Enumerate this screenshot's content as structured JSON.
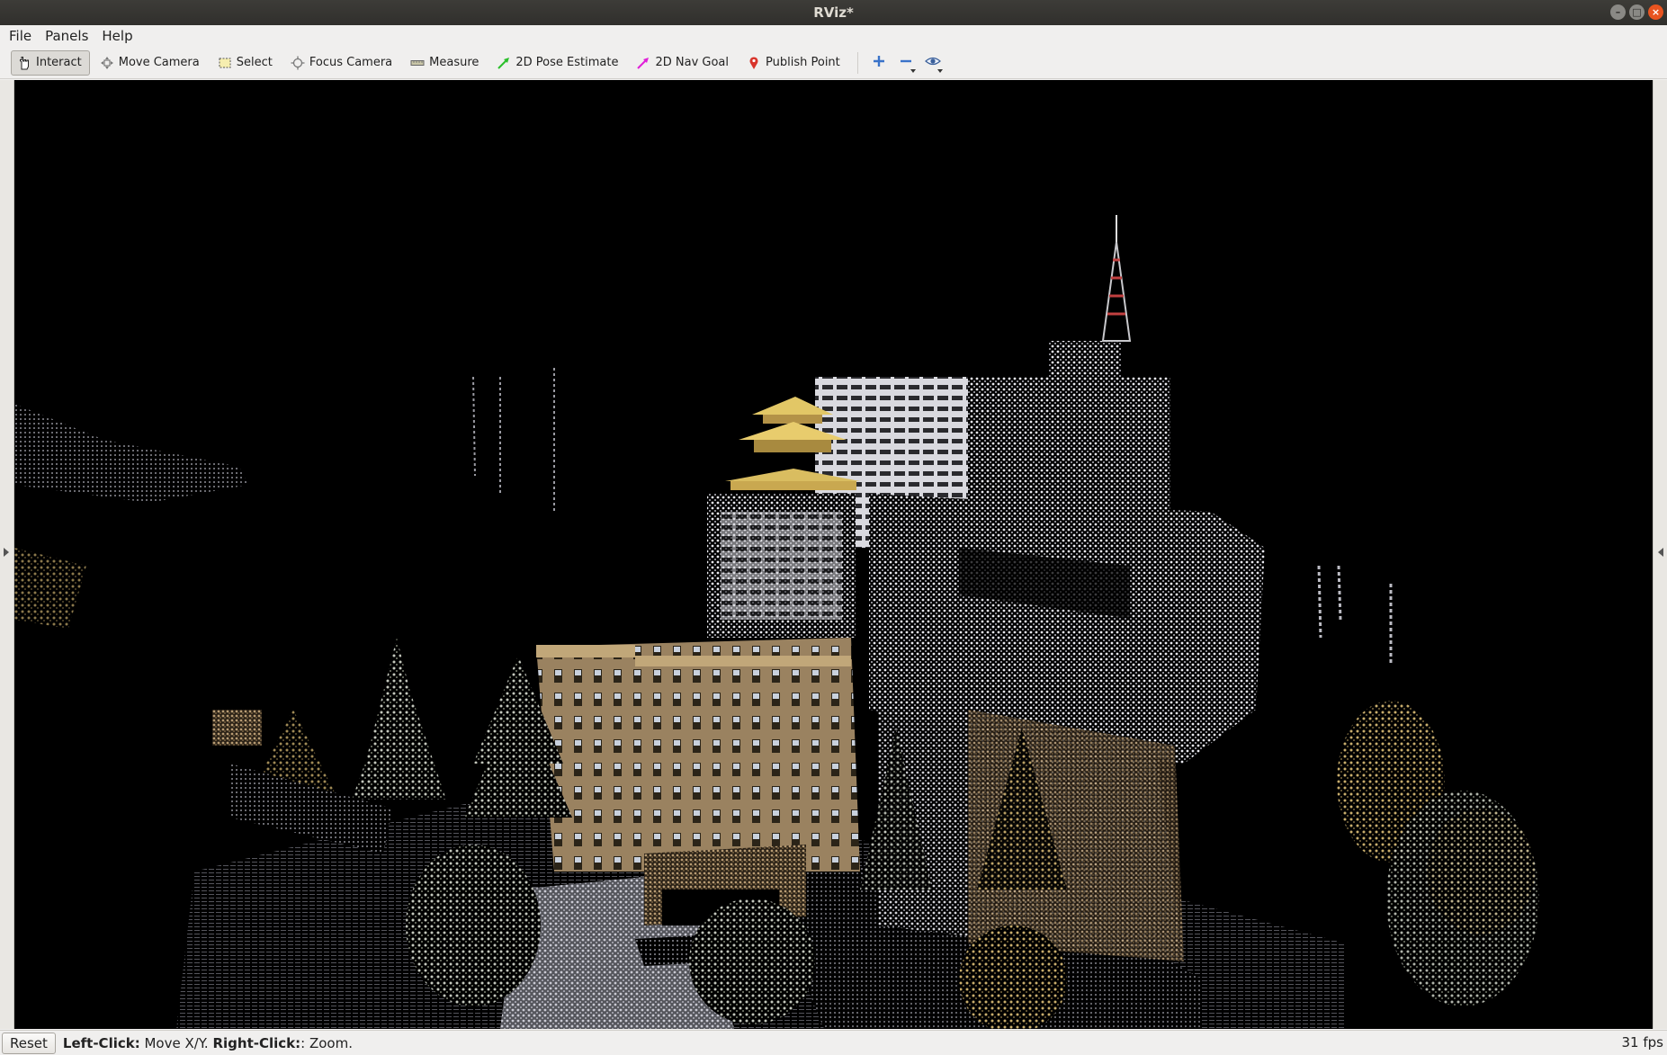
{
  "window": {
    "title": "RViz*",
    "minimize_glyph": "–",
    "maximize_glyph": "□",
    "close_glyph": "×"
  },
  "menu": [
    "File",
    "Panels",
    "Help"
  ],
  "toolbar": {
    "tools": [
      {
        "label": "Interact",
        "icon": "hand-icon",
        "active": true
      },
      {
        "label": "Move Camera",
        "icon": "move-camera-icon",
        "active": false
      },
      {
        "label": "Select",
        "icon": "select-box-icon",
        "active": false
      },
      {
        "label": "Focus Camera",
        "icon": "focus-camera-icon",
        "active": false
      },
      {
        "label": "Measure",
        "icon": "ruler-icon",
        "active": false
      },
      {
        "label": "2D Pose Estimate",
        "icon": "green-arrow-icon",
        "active": false
      },
      {
        "label": "2D Nav Goal",
        "icon": "magenta-arrow-icon",
        "active": false
      },
      {
        "label": "Publish Point",
        "icon": "map-pin-icon",
        "active": false
      }
    ],
    "extra_buttons": [
      "add-tool-icon",
      "remove-tool-icon",
      "view-options-icon"
    ]
  },
  "viewport": {
    "content": "point-cloud-3d-view",
    "background": "#000000"
  },
  "status": {
    "reset_label": "Reset",
    "left_click_label": "Left-Click:",
    "left_click_action": " Move X/Y. ",
    "right_click_label": "Right-Click:",
    "right_click_action": ": Zoom.",
    "fps": "31 fps"
  },
  "colors": {
    "titlebar": "#302f2c",
    "accent_close": "#e95420",
    "window_bg": "#f0efee"
  }
}
